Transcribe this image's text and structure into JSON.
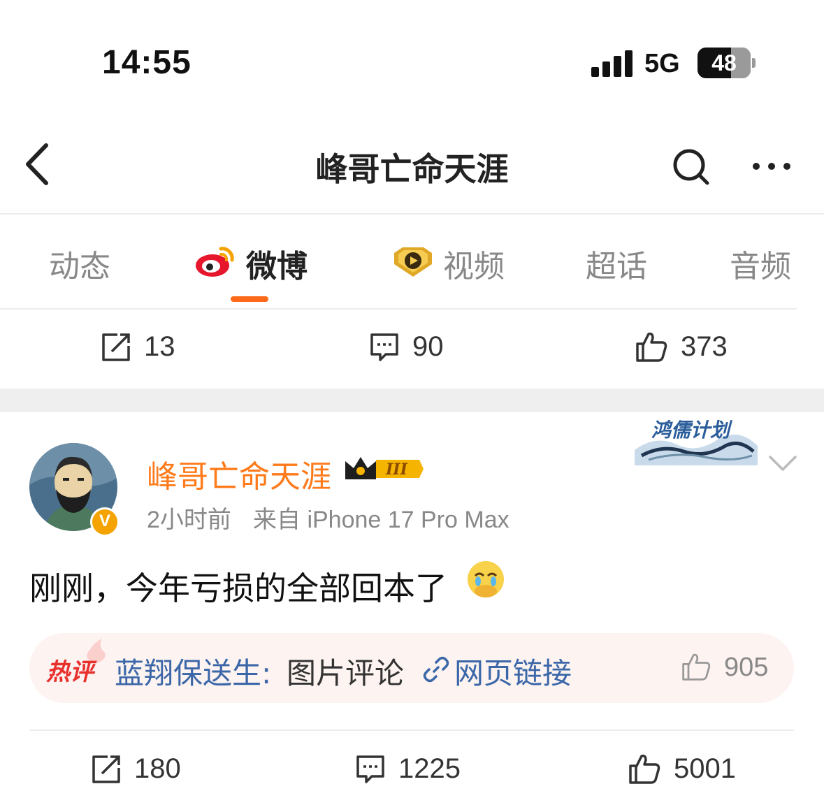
{
  "status_bar": {
    "time": "14:55",
    "network": "5G",
    "battery": "48"
  },
  "nav": {
    "title": "峰哥亡命天涯",
    "back_icon": "chevron-left-icon",
    "search_icon": "search-icon",
    "more_icon": "ellipsis-icon"
  },
  "tabs": [
    {
      "label": "动态",
      "active": false
    },
    {
      "label": "微博",
      "active": true
    },
    {
      "label": "视频",
      "active": false
    },
    {
      "label": "超话",
      "active": false
    },
    {
      "label": "音频",
      "active": false
    }
  ],
  "accent_color": "#ff6a1a",
  "previous_post_actions": {
    "reposts": "13",
    "comments": "90",
    "likes": "373"
  },
  "post": {
    "user": "峰哥亡命天涯",
    "level": "III",
    "verified_badge": "V",
    "time": "2小时前",
    "source": "来自 iPhone 17 Pro Max",
    "campaign_badge": "鸿儒计划",
    "text": "刚刚，今年亏损的全部回本了",
    "hot_comment": {
      "tag": "热评",
      "user": "蓝翔保送生:",
      "content": "图片评论",
      "link": "网页链接",
      "likes": "905"
    },
    "actions": {
      "reposts": "180",
      "comments": "1225",
      "likes": "5001"
    }
  }
}
